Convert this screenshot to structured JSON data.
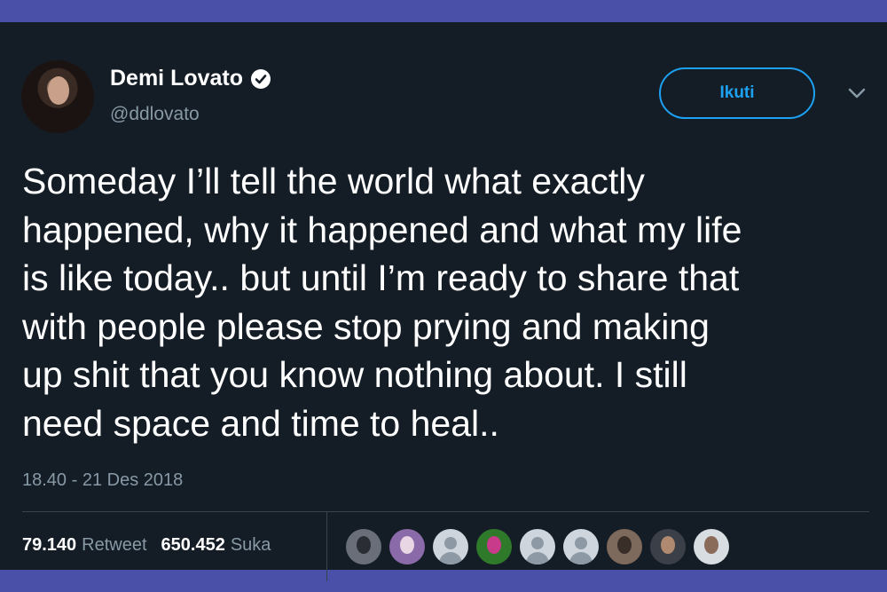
{
  "author": {
    "name": "Demi Lovato",
    "handle": "@ddlovato",
    "verified": true
  },
  "follow_button": {
    "label": "Ikuti"
  },
  "tweet": {
    "text": "Someday I’ll tell the world what exactly\nhappened, why it happened  and what my life\nis like today.. but until I’m ready to share that\nwith people please stop prying and making\nup shit that you know nothing about. I still\nneed space and time to heal..",
    "timestamp": "18.40 - 21 Des 2018"
  },
  "stats": {
    "retweets": "79.140",
    "retweets_label": "Retweet",
    "likes": "650.452",
    "likes_label": "Suka"
  },
  "likers": [
    {
      "type": "photo",
      "bg": "#6a6e78",
      "fg": "#2a2d33"
    },
    {
      "type": "photo",
      "bg": "#8a6aa8",
      "fg": "#e8d6e4"
    },
    {
      "type": "default"
    },
    {
      "type": "photo",
      "bg": "#2f7a2a",
      "fg": "#c83a8a"
    },
    {
      "type": "default"
    },
    {
      "type": "default"
    },
    {
      "type": "photo",
      "bg": "#7d6a5c",
      "fg": "#3a2e28"
    },
    {
      "type": "photo",
      "bg": "#3b4048",
      "fg": "#b08a70"
    },
    {
      "type": "photo",
      "bg": "#d8dde2",
      "fg": "#8a6a58"
    }
  ],
  "colors": {
    "background": "#141d26",
    "accent": "#1da1f2",
    "muted": "#8899a6",
    "frame": "#4a4fa8"
  },
  "icons": {
    "verified": "verified-badge-icon",
    "caret": "chevron-down-icon"
  }
}
